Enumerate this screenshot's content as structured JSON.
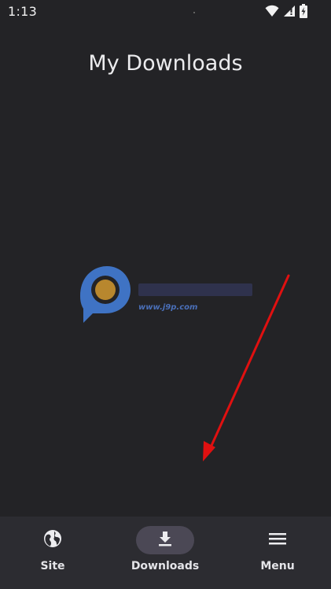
{
  "status_bar": {
    "time": "1:13",
    "icons": [
      "wifi-icon",
      "signal-icon",
      "battery-charging-icon"
    ]
  },
  "page": {
    "title": "My Downloads"
  },
  "watermark": {
    "url": "www.j9p.com"
  },
  "bottom_nav": {
    "items": [
      {
        "label": "Site",
        "icon": "globe-icon",
        "active": false
      },
      {
        "label": "Downloads",
        "icon": "download-icon",
        "active": true
      },
      {
        "label": "Menu",
        "icon": "menu-icon",
        "active": false
      }
    ]
  },
  "colors": {
    "background": "#232326",
    "nav_background": "#2c2c31",
    "active_pill": "#4b4855",
    "annotation_arrow": "#e01010"
  }
}
